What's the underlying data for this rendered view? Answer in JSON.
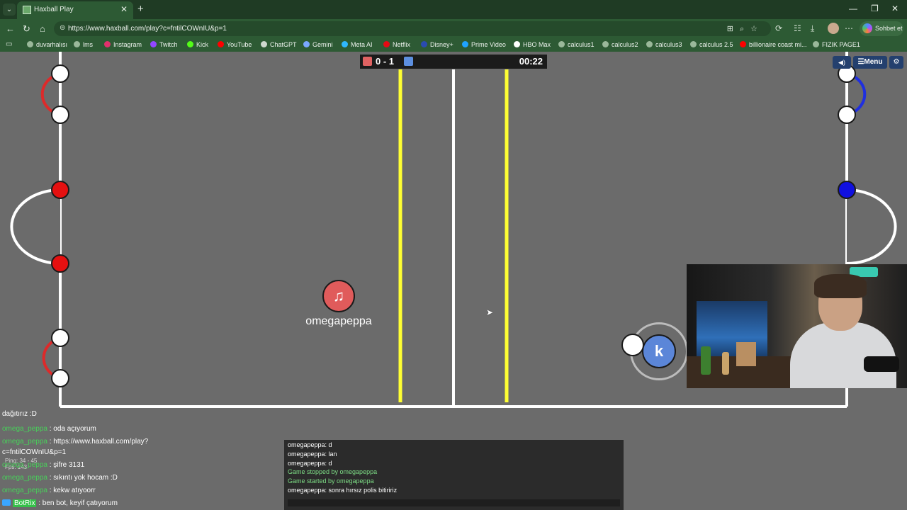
{
  "browser": {
    "tab_title": "Haxball Play",
    "url": "https://www.haxball.com/play?c=fntilCOWnIU&p=1",
    "copilot_label": "Sohbet et",
    "bookmarks": [
      "duvarhalısı",
      "lms",
      "Instagram",
      "Twitch",
      "Kick",
      "YouTube",
      "ChatGPT",
      "Gemini",
      "Meta AI",
      "Netflix",
      "Disney+",
      "Prime Video",
      "HBO Max",
      "calculus1",
      "calculus2",
      "calculus3",
      "calculus 2.5",
      "billionaire coast mi...",
      "FIZIK PAGE1"
    ]
  },
  "game": {
    "score": "0 - 1",
    "time": "00:22",
    "menu_label": "☰Menu",
    "red_player": {
      "name": "omegapeppa",
      "avatar": "♫"
    },
    "blue_player": {
      "avatar": "k"
    },
    "colors": {
      "red": "#e05b5b",
      "blue": "#5b86d8",
      "field": "#6b6b6b",
      "line": "#ffffff",
      "barrier": "#ffff33"
    }
  },
  "overlay_chat": {
    "lines": [
      {
        "user": "",
        "text": "dağıtırız :D"
      },
      {
        "user": "omega_peppa",
        "text": " : oda açıyorum"
      },
      {
        "user": "omega_peppa",
        "text": " : https://www.haxball.com/play?"
      },
      {
        "user": "",
        "text": "c=fntilCOWnIU&p=1"
      },
      {
        "user": "omega_peppa",
        "text": " : şifre 3131"
      },
      {
        "user": "omega_peppa",
        "text": " : sıkıntı yok hocam :D"
      },
      {
        "user": "omega_peppa",
        "text": " : kekw atıyoorr"
      },
      {
        "user": "BotRix",
        "text": " : ben bot, keyif çatıyorum"
      }
    ],
    "ping": "Ping: 34 - 45",
    "fps": "Fps: 143"
  },
  "game_chat": {
    "lines": [
      {
        "type": "msg",
        "text": "omegapeppa: d"
      },
      {
        "type": "msg",
        "text": "omegapeppa: lan"
      },
      {
        "type": "msg",
        "text": "omegapeppa: d"
      },
      {
        "type": "sys",
        "text": "Game stopped by omegapeppa"
      },
      {
        "type": "sys",
        "text": "Game started by omegapeppa"
      },
      {
        "type": "msg",
        "text": "omegapeppa: sonra hırsız polis bitiririz"
      }
    ]
  }
}
